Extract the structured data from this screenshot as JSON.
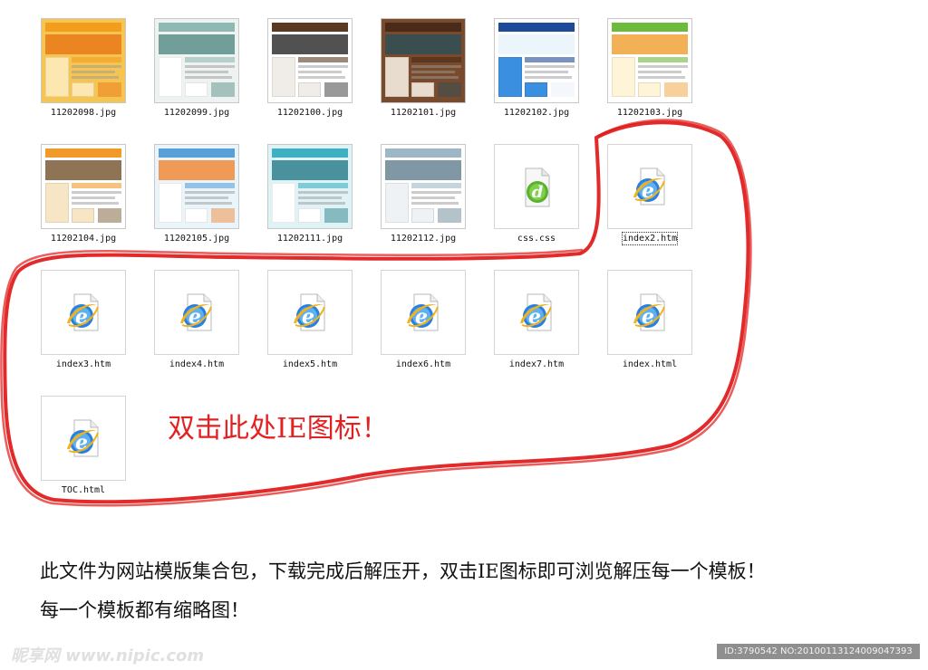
{
  "files": [
    {
      "name": "11202098.jpg",
      "kind": "image",
      "theme": {
        "bg": "#f6c451",
        "band": "#f39c1e",
        "block": "#fde7b0",
        "accent": "#e87a1a"
      }
    },
    {
      "name": "11202099.jpg",
      "kind": "image",
      "theme": {
        "bg": "#eef2f0",
        "band": "#8fb9b3",
        "block": "#ffffff",
        "accent": "#5a8f8a"
      }
    },
    {
      "name": "11202100.jpg",
      "kind": "image",
      "theme": {
        "bg": "#ffffff",
        "band": "#5b3a22",
        "block": "#f0ede8",
        "accent": "#333333"
      }
    },
    {
      "name": "11202101.jpg",
      "kind": "image",
      "theme": {
        "bg": "#7a4a2c",
        "band": "#4a2a18",
        "block": "#e8dccf",
        "accent": "#2f4f57"
      }
    },
    {
      "name": "11202102.jpg",
      "kind": "image",
      "theme": {
        "bg": "#ffffff",
        "band": "#1e4a9a",
        "block": "#3b8fe0",
        "accent": "#e9f2fb"
      }
    },
    {
      "name": "11202103.jpg",
      "kind": "image",
      "theme": {
        "bg": "#ffffff",
        "band": "#6dbb3a",
        "block": "#fef4d8",
        "accent": "#f0a23a"
      }
    },
    {
      "name": "11202104.jpg",
      "kind": "image",
      "theme": {
        "bg": "#ffffff",
        "band": "#f09a2a",
        "block": "#f7e6c6",
        "accent": "#7a5b36"
      }
    },
    {
      "name": "11202105.jpg",
      "kind": "image",
      "theme": {
        "bg": "#eaf4fb",
        "band": "#5aa0d8",
        "block": "#ffffff",
        "accent": "#f08a3a"
      }
    },
    {
      "name": "11202111.jpg",
      "kind": "image",
      "theme": {
        "bg": "#dff3f6",
        "band": "#3fb0c2",
        "block": "#ffffff",
        "accent": "#2f7f8c"
      }
    },
    {
      "name": "11202112.jpg",
      "kind": "image",
      "theme": {
        "bg": "#ffffff",
        "band": "#9eb7c7",
        "block": "#eef2f4",
        "accent": "#6a8596"
      }
    },
    {
      "name": "css.css",
      "kind": "css"
    },
    {
      "name": "index2.htm",
      "kind": "ie",
      "selected": true
    },
    {
      "name": "index3.htm",
      "kind": "ie"
    },
    {
      "name": "index4.htm",
      "kind": "ie"
    },
    {
      "name": "index5.htm",
      "kind": "ie"
    },
    {
      "name": "index6.htm",
      "kind": "ie"
    },
    {
      "name": "index7.htm",
      "kind": "ie"
    },
    {
      "name": "index.html",
      "kind": "ie"
    },
    {
      "name": "TOC.html",
      "kind": "ie"
    }
  ],
  "annotation": "双击此处IE图标！",
  "description": {
    "line1": "此文件为网站模版集合包，下载完成后解压开，双击IE图标即可浏览解压每一个模板！",
    "line2": "每一个模板都有缩略图！"
  },
  "watermark": "昵享网 www.nipic.com",
  "image_id": "ID:3790542 NO:20100113124009047393",
  "colors": {
    "annotation": "#e42020",
    "scribble": "#e01818",
    "ie_blue": "#1f6fd0",
    "ie_gold": "#f2b21b",
    "css_green": "#5bb02f"
  }
}
